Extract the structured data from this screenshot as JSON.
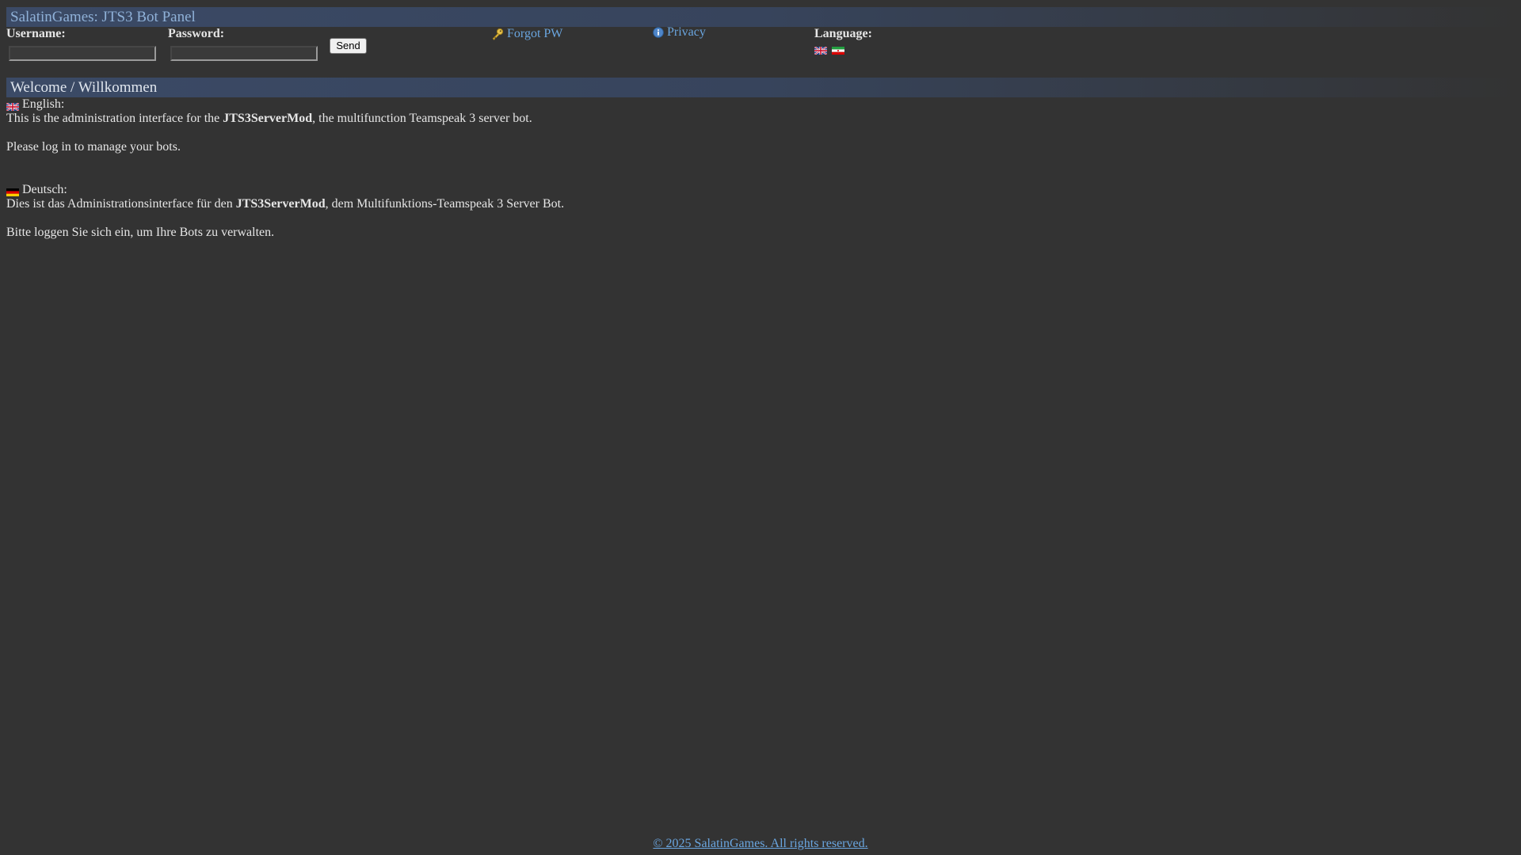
{
  "header": {
    "title": "SalatinGames: JTS3 Bot Panel"
  },
  "login": {
    "username_label": "Username:",
    "username_value": "",
    "password_label": "Password:",
    "password_value": "",
    "send_label": "Send"
  },
  "links": {
    "forgot_pw": "Forgot PW",
    "privacy": "Privacy"
  },
  "language": {
    "label": "Language:",
    "flags": [
      "uk-flag-icon",
      "ir-flag-icon"
    ]
  },
  "welcome": {
    "heading": "Welcome / Willkommen",
    "english": {
      "label": "English:",
      "line1_pre": "This is the administration interface for the ",
      "line1_bold": "JTS3ServerMod",
      "line1_post": ", the multifunction Teamspeak 3 server bot.",
      "line2": "Please log in to manage your bots."
    },
    "deutsch": {
      "label": "Deutsch:",
      "line1_pre": "Dies ist das Administrationsinterface für den ",
      "line1_bold": "JTS3ServerMod",
      "line1_post": ", dem Multifunktions-Teamspeak 3 Server Bot.",
      "line2": "Bitte loggen Sie sich ein, um Ihre Bots zu verwalten."
    }
  },
  "footer": {
    "copyright": "© 2025 SalatinGames. All rights reserved."
  },
  "colors": {
    "background": "#333333",
    "bar": "#3b4a66",
    "link": "#6aa6e0"
  }
}
